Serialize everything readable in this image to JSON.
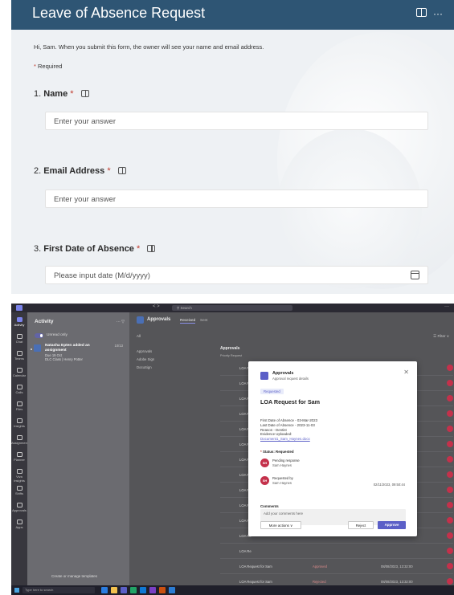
{
  "forms": {
    "title": "Leave of Absence Request",
    "more_glyph": "···",
    "intro": "Hi, Sam. When you submit this form, the owner will see your name and email address.",
    "required_marker": "*",
    "required_text": " Required",
    "questions": [
      {
        "number": "1.",
        "label": "Name",
        "placeholder": "Enter your answer"
      },
      {
        "number": "2.",
        "label": "Email Address",
        "placeholder": "Enter your answer"
      },
      {
        "number": "3.",
        "label": "First Date of Absence",
        "placeholder": "Please input date (M/d/yyyy)"
      }
    ]
  },
  "teams": {
    "search_placeholder": "Search",
    "nav_arrows": "<  >",
    "more_glyph": "···",
    "rail": [
      {
        "label": "Activity"
      },
      {
        "label": "Chat"
      },
      {
        "label": "Teams"
      },
      {
        "label": "Calendar"
      },
      {
        "label": "Calls"
      },
      {
        "label": "Files"
      },
      {
        "label": "Insights"
      },
      {
        "label": "Assignments"
      },
      {
        "label": "Planner"
      },
      {
        "label": "Viva Insights"
      },
      {
        "label": "Shifts"
      },
      {
        "label": "Approvals"
      },
      {
        "label": "Apps"
      }
    ],
    "activity": {
      "title": "Activity",
      "header_icons": "···  ▽",
      "unread_only": "Unread only",
      "notification": {
        "title": "Natasha Epten added an assignment",
        "date": "10/13",
        "due": "Due 19 Oct",
        "class": "DLC Class | Henry Potter"
      },
      "manage_templates": "Create or manage templates"
    },
    "approvals": {
      "title": "Approvals",
      "tab_received": "Received",
      "tab_sent": "Sent",
      "all": "All",
      "filter": "☰ Filter ∨",
      "left_links": [
        "Approvals",
        "Adobe Sign",
        "DocuSign"
      ],
      "section_label": "Approvals",
      "columns": "Priority     Request",
      "rows": [
        {
          "name": "LOA Re",
          "status": "",
          "date": ""
        },
        {
          "name": "LOA Re",
          "status": "",
          "date": ""
        },
        {
          "name": "LOA Re",
          "status": "",
          "date": ""
        },
        {
          "name": "LOA Re",
          "status": "",
          "date": ""
        },
        {
          "name": "LOA Re",
          "status": "",
          "date": ""
        },
        {
          "name": "LOA Re",
          "status": "",
          "date": ""
        },
        {
          "name": "LOA Re",
          "status": "",
          "date": ""
        },
        {
          "name": "LOA Re",
          "status": "",
          "date": ""
        },
        {
          "name": "LOA Re",
          "status": "",
          "date": ""
        },
        {
          "name": "LOA Re",
          "status": "",
          "date": ""
        },
        {
          "name": "LOA Re",
          "status": "",
          "date": ""
        },
        {
          "name": "LOA Re",
          "status": "",
          "date": ""
        },
        {
          "name": "LOA Re",
          "status": "",
          "date": ""
        },
        {
          "name": "LOA Request for Sam",
          "status": "Approved",
          "date": "08/08/2023, 13:32:00"
        },
        {
          "name": "LOA Request for Sam",
          "status": "Rejected",
          "date": "08/08/2023, 13:32:00"
        },
        {
          "name": "LOA Request for Sam",
          "status": "Approved",
          "date": "08/08/2023, 13:32:00"
        },
        {
          "name": "LOA Request for Sam",
          "status": "Approved",
          "date": "08/08/2023, 13:32:00"
        }
      ]
    },
    "modal": {
      "title": "Approvals",
      "subtitle": "Approval request details",
      "status_pill": "Requested",
      "request_title": "LOA Request for Sam",
      "details": [
        "First Date of Absence - 03-Mar-2023",
        "Last Date of Absence - 2023-11-03",
        "Reason - Dentist",
        "Evidence Uploaded:"
      ],
      "doc_link": "Document1_Sam_Haynes.docx",
      "status_header": "Status: Requested",
      "pending": {
        "initials": "SH",
        "line1": "Pending response",
        "line2": "Sam Haynes"
      },
      "requested_by": {
        "initials": "SH",
        "line1": "Requested by",
        "line2": "Sam Haynes",
        "timestamp": "02/11/2023, 09:50:44"
      },
      "close_glyph": "✕",
      "comments_label": "Comments",
      "comments_placeholder": "Add your comments here",
      "more_actions": "More actions ∨",
      "reject": "Reject",
      "approve": "Approve"
    },
    "taskbar": {
      "search": "Type here to search"
    }
  },
  "colors": {
    "forms_header": "#2e5574",
    "required_star": "#c0392b",
    "teams_accent": "#5b5fc7",
    "avatar_red": "#c4314b"
  }
}
